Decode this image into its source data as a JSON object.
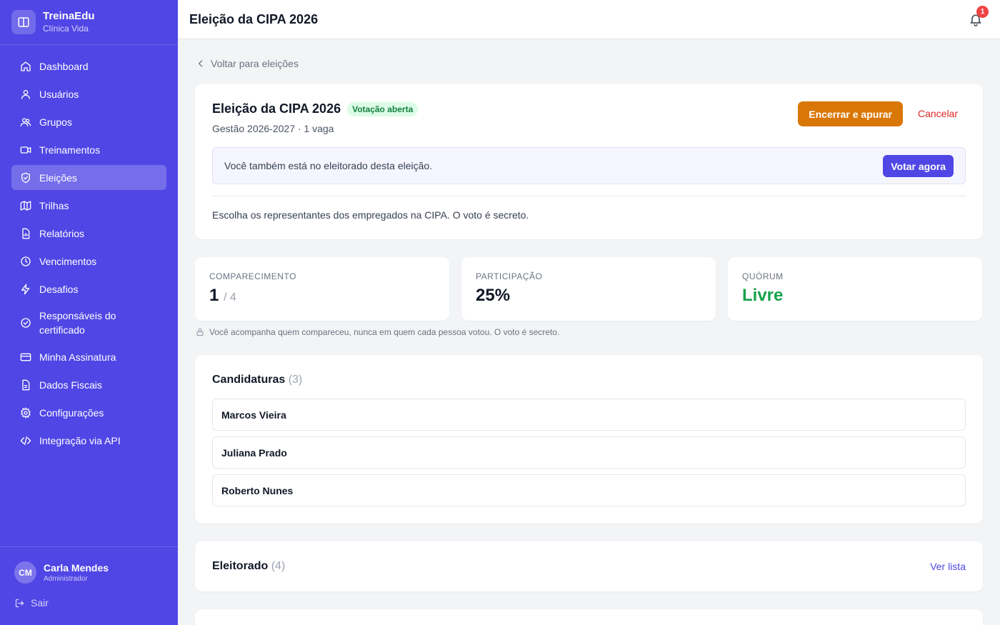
{
  "brand": {
    "name": "TreinaEdu",
    "org": "Clínica Vida"
  },
  "sidebar": {
    "items": [
      {
        "label": "Dashboard",
        "icon": "home-icon"
      },
      {
        "label": "Usuários",
        "icon": "user-icon"
      },
      {
        "label": "Grupos",
        "icon": "users-icon"
      },
      {
        "label": "Treinamentos",
        "icon": "video-icon"
      },
      {
        "label": "Eleições",
        "icon": "shield-icon",
        "active": true
      },
      {
        "label": "Trilhas",
        "icon": "map-icon"
      },
      {
        "label": "Relatórios",
        "icon": "report-icon"
      },
      {
        "label": "Vencimentos",
        "icon": "clock-icon"
      },
      {
        "label": "Desafios",
        "icon": "bolt-icon"
      },
      {
        "label": "Responsáveis do certificado",
        "icon": "check-circle-icon"
      },
      {
        "label": "Minha Assinatura",
        "icon": "credit-card-icon"
      },
      {
        "label": "Dados Fiscais",
        "icon": "document-icon"
      },
      {
        "label": "Configurações",
        "icon": "gear-icon"
      },
      {
        "label": "Integração via API",
        "icon": "code-icon"
      }
    ]
  },
  "user": {
    "initials": "CM",
    "name": "Carla Mendes",
    "role": "Administrador",
    "logout": "Sair"
  },
  "header": {
    "title": "Eleição da CIPA 2026",
    "notifications": "1"
  },
  "back": {
    "label": "Voltar para eleições"
  },
  "election": {
    "title": "Eleição da CIPA 2026",
    "status": "Votação aberta",
    "subtitle": "Gestão 2026-2027 · 1 vaga",
    "close_button": "Encerrar e apurar",
    "cancel_button": "Cancelar",
    "voter_notice": "Você também está no eleitorado desta eleição.",
    "vote_button": "Votar agora",
    "description": "Escolha os representantes dos empregados na CIPA. O voto é secreto."
  },
  "stats": {
    "attendance": {
      "label": "COMPARECIMENTO",
      "value": "1",
      "total": "/ 4"
    },
    "participation": {
      "label": "PARTICIPAÇÃO",
      "value": "25%"
    },
    "quorum": {
      "label": "QUÓRUM",
      "value": "Livre"
    },
    "privacy_note": "Você acompanha quem compareceu, nunca em quem cada pessoa votou. O voto é secreto."
  },
  "candidates": {
    "title": "Candidaturas",
    "count": "(3)",
    "items": [
      "Marcos Vieira",
      "Juliana Prado",
      "Roberto Nunes"
    ]
  },
  "electorate": {
    "title": "Eleitorado",
    "count": "(4)",
    "link": "Ver lista"
  },
  "colors": {
    "primary": "#4f46e5",
    "warning": "#d97706",
    "danger": "#dc2626",
    "success": "#16a34a"
  }
}
